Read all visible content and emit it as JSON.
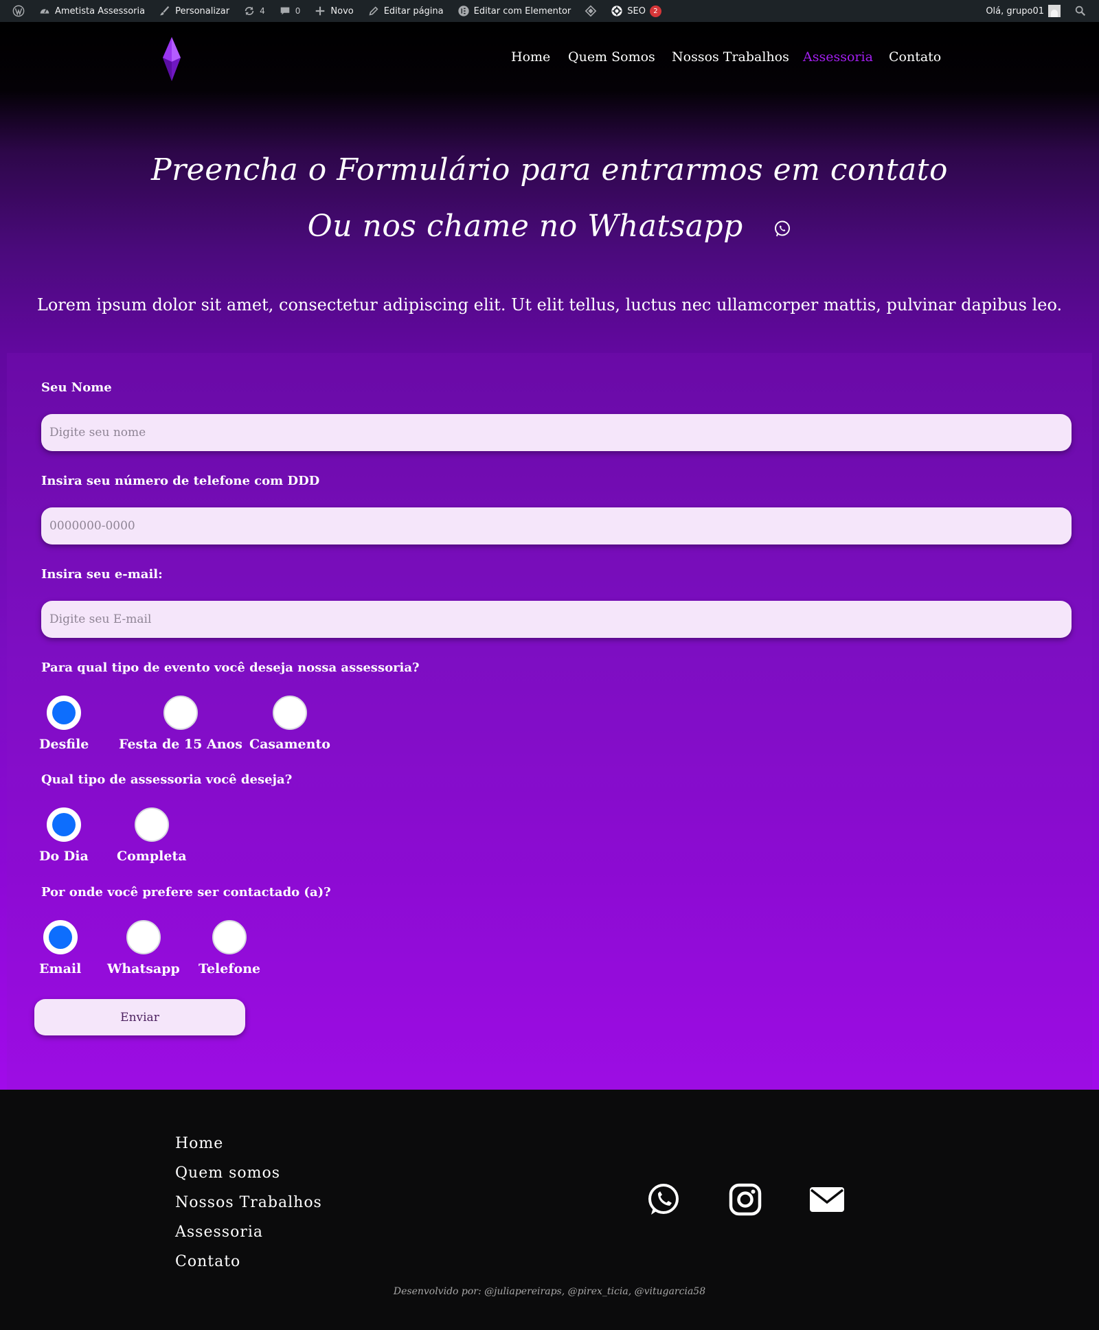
{
  "admin_bar": {
    "site_name": "Ametista Assessoria",
    "customize": "Personalizar",
    "updates_count": "4",
    "comments_count": "0",
    "new": "Novo",
    "edit_page": "Editar página",
    "edit_elementor": "Editar com Elementor",
    "seo": "SEO",
    "seo_badge": "2",
    "greeting": "Olá, grupo01"
  },
  "nav": {
    "items": [
      "Home",
      "Quem Somos",
      "Nossos Trabalhos",
      "Assessoria",
      "Contato"
    ],
    "active": "Assessoria",
    "active_color": "#a31ff0"
  },
  "hero": {
    "title_line1": "Preencha o Formulário para entrarmos em contato",
    "title_line2": "Ou nos chame no Whatsapp",
    "lead": "Lorem ipsum dolor sit amet, consectetur adipiscing elit. Ut elit tellus, luctus nec ullamcorper mattis, pulvinar dapibus leo."
  },
  "form": {
    "name_label": "Seu Nome",
    "name_placeholder": "Digite seu nome",
    "phone_label": "Insira seu número de telefone com DDD",
    "phone_placeholder": "0000000-0000",
    "email_label": "Insira seu e-mail:",
    "email_placeholder": "Digite seu E-mail",
    "event_label": "Para qual tipo de evento você deseja nossa assessoria?",
    "event_options": [
      "Desfile",
      "Festa de 15 Anos",
      "Casamento"
    ],
    "event_selected": "Desfile",
    "service_label": "Qual tipo de assessoria você deseja?",
    "service_options": [
      "Do Dia",
      "Completa"
    ],
    "service_selected": "Do Dia",
    "contact_label": "Por onde você prefere ser contactado (a)?",
    "contact_options": [
      "Email",
      "Whatsapp",
      "Telefone"
    ],
    "contact_selected": "Email",
    "submit": "Enviar",
    "radio_checked_color": "#0d6efd"
  },
  "footer": {
    "links": [
      "Home",
      "Quem somos",
      "Nossos Trabalhos",
      "Assessoria",
      "Contato"
    ],
    "social_icons": [
      "whatsapp-icon",
      "instagram-icon",
      "envelope-icon"
    ],
    "credits": "Desenvolvido por: @juliapereiraps, @pirex_ticia, @vitugarcia58"
  },
  "colors": {
    "brand_purple": "#a31ff0",
    "input_background": "#f5e6fa",
    "footer_background": "#0b0b0c"
  }
}
